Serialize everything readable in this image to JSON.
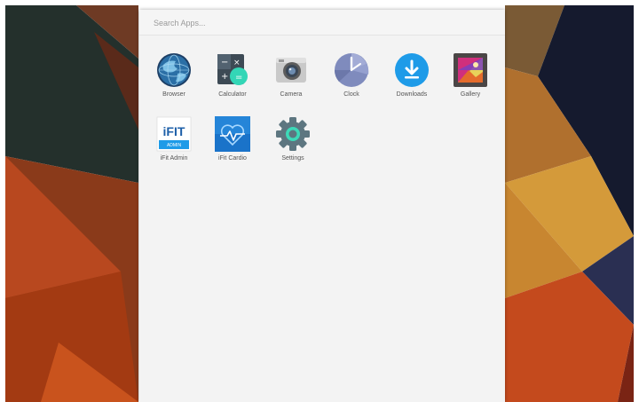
{
  "search": {
    "placeholder": "Search Apps..."
  },
  "apps": [
    {
      "label": "Browser",
      "icon": "globe-icon"
    },
    {
      "label": "Calculator",
      "icon": "calculator-icon"
    },
    {
      "label": "Camera",
      "icon": "camera-icon"
    },
    {
      "label": "Clock",
      "icon": "clock-icon"
    },
    {
      "label": "Downloads",
      "icon": "download-icon"
    },
    {
      "label": "Gallery",
      "icon": "gallery-icon"
    },
    {
      "label": "iFit Admin",
      "icon": "ifit-admin-icon",
      "logo_text": "iFIT",
      "logo_subtext": "ADMIN"
    },
    {
      "label": "iFit Cardio",
      "icon": "ifit-cardio-icon"
    },
    {
      "label": "Settings",
      "icon": "settings-icon"
    }
  ],
  "colors": {
    "drawer_background": "#f3f3f3",
    "downloads_blue": "#1e9be8",
    "calculator_teal": "#33d6b6",
    "ifit_blue": "#1a73c9"
  }
}
